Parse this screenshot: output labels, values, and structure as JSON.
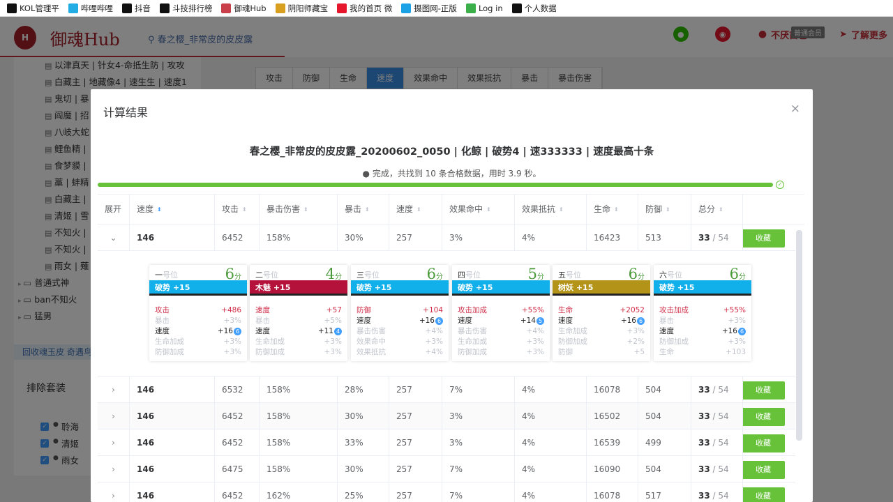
{
  "bookmarks": [
    {
      "label": "KOL管理平",
      "icon": "dawa-icon",
      "color": "#111111"
    },
    {
      "label": "哔哩哔哩",
      "icon": "bilibili-icon",
      "color": "#23ade5"
    },
    {
      "label": "抖音",
      "icon": "tiktok-icon",
      "color": "#111111"
    },
    {
      "label": "斗技排行榜",
      "icon": "dawa-icon",
      "color": "#111111"
    },
    {
      "label": "御魂Hub",
      "icon": "hub-icon",
      "color": "#c9404a"
    },
    {
      "label": "阴阳师藏宝",
      "icon": "cbg-icon",
      "color": "#d9a020"
    },
    {
      "label": "我的首页 微",
      "icon": "weibo-icon",
      "color": "#e6162d"
    },
    {
      "label": "摄图网-正版",
      "icon": "photo-icon",
      "color": "#1aa1e6"
    },
    {
      "label": "Log in",
      "icon": "px-icon",
      "color": "#3bb04a"
    },
    {
      "label": "个人数据",
      "icon": "dawa-icon",
      "color": "#111111"
    }
  ],
  "header": {
    "logo_text": "御魂Hub",
    "search_text": "春之樱_非常皮的皮皮露",
    "user_name": "不厌酋色",
    "member_badge": "普通会员",
    "more_link": "了解更多"
  },
  "sidebar": {
    "tree_items": [
      "以津真天 | 针女4-命抵生防 | 攻攻",
      "白藏主 | 地藏像4 | 速生生 | 速度1",
      "鬼切 | 暴",
      "阎魔 | 招",
      "八岐大蛇",
      "鲤鱼精 |",
      "食梦貘 |",
      "藁 | 蚌精",
      "白藏主 |",
      "清姬 | 雪",
      "不知火 |",
      "不知火 |",
      "雨女 | 薙"
    ],
    "folders": [
      "普通式神",
      "ban不知火",
      "猛男"
    ],
    "bar_text": "回收魂玉皮 奇遇鸟",
    "exclude_title": "排除套装",
    "checked_items": [
      "聆海",
      "清姬",
      "雨女"
    ]
  },
  "bg_tabs": [
    "攻击",
    "防御",
    "生命",
    "速度",
    "效果命中",
    "效果抵抗",
    "暴击",
    "暴击伤害"
  ],
  "bg_active_tab": "速度",
  "modal": {
    "title": "计算结果",
    "close_label": "×",
    "result_title": "春之樱_非常皮的皮皮露_20200602_0050 | 化鲸 | 破势4 | 速333333 | 速度最高十条",
    "done_text": "完成，共找到 10 条合格数据，用时 3.9 秒。",
    "progress_pct": 100,
    "columns": [
      "展开",
      "速度",
      "攻击",
      "暴击伤害",
      "暴击",
      "速度",
      "效果命中",
      "效果抵抗",
      "生命",
      "防御",
      "总分"
    ],
    "fav_label": "收藏",
    "rows": [
      {
        "speed": "146",
        "atk": "6452",
        "cdmg": "158%",
        "crit": "30%",
        "spd": "257",
        "hit": "3%",
        "res": "4%",
        "hp": "16423",
        "def": "513",
        "score": "33",
        "total": " / 54"
      },
      {
        "speed": "146",
        "atk": "6532",
        "cdmg": "158%",
        "crit": "28%",
        "spd": "257",
        "hit": "7%",
        "res": "4%",
        "hp": "16078",
        "def": "504",
        "score": "33",
        "total": " / 54"
      },
      {
        "speed": "146",
        "atk": "6452",
        "cdmg": "158%",
        "crit": "30%",
        "spd": "257",
        "hit": "3%",
        "res": "4%",
        "hp": "16502",
        "def": "504",
        "score": "33",
        "total": " / 54"
      },
      {
        "speed": "146",
        "atk": "6452",
        "cdmg": "158%",
        "crit": "33%",
        "spd": "257",
        "hit": "3%",
        "res": "4%",
        "hp": "16539",
        "def": "499",
        "score": "33",
        "total": " / 54"
      },
      {
        "speed": "146",
        "atk": "6475",
        "cdmg": "158%",
        "crit": "30%",
        "spd": "257",
        "hit": "7%",
        "res": "4%",
        "hp": "16090",
        "def": "504",
        "score": "33",
        "total": " / 54"
      },
      {
        "speed": "146",
        "atk": "6452",
        "cdmg": "162%",
        "crit": "25%",
        "spd": "257",
        "hit": "7%",
        "res": "4%",
        "hp": "16078",
        "def": "517",
        "score": "33",
        "total": " / 54"
      }
    ],
    "cards": [
      {
        "pos_num": "一",
        "pos_suffix": "号位",
        "score": "6",
        "score_unit": "分",
        "set": "破势 +15",
        "band_color": "#12b0ea",
        "stats": [
          {
            "name": "攻击",
            "val": "+486",
            "kind": "main"
          },
          {
            "name": "暴击",
            "val": "+3%",
            "kind": "sub"
          },
          {
            "name": "速度",
            "val": "+16",
            "roll": "6",
            "kind": "spd"
          },
          {
            "name": "生命加成",
            "val": "+3%",
            "kind": "sub"
          },
          {
            "name": "防御加成",
            "val": "+3%",
            "kind": "sub"
          }
        ]
      },
      {
        "pos_num": "二",
        "pos_suffix": "号位",
        "score": "4",
        "score_unit": "分",
        "set": "木魅 +15",
        "band_color": "#b5123b",
        "stats": [
          {
            "name": "速度",
            "val": "+57",
            "kind": "main"
          },
          {
            "name": "暴击",
            "val": "+5%",
            "kind": "sub"
          },
          {
            "name": "速度",
            "val": "+11",
            "roll": "4",
            "kind": "spd"
          },
          {
            "name": "生命加成",
            "val": "+3%",
            "kind": "sub"
          },
          {
            "name": "防御加成",
            "val": "+3%",
            "kind": "sub"
          }
        ]
      },
      {
        "pos_num": "三",
        "pos_suffix": "号位",
        "score": "6",
        "score_unit": "分",
        "set": "破势 +15",
        "band_color": "#12b0ea",
        "stats": [
          {
            "name": "防御",
            "val": "+104",
            "kind": "main"
          },
          {
            "name": "速度",
            "val": "+16",
            "roll": "6",
            "kind": "spd"
          },
          {
            "name": "暴击伤害",
            "val": "+4%",
            "kind": "sub"
          },
          {
            "name": "效果命中",
            "val": "+3%",
            "kind": "sub"
          },
          {
            "name": "效果抵抗",
            "val": "+4%",
            "kind": "sub"
          }
        ]
      },
      {
        "pos_num": "四",
        "pos_suffix": "号位",
        "score": "5",
        "score_unit": "分",
        "set": "破势 +15",
        "band_color": "#12b0ea",
        "stats": [
          {
            "name": "攻击加成",
            "val": "+55%",
            "kind": "main"
          },
          {
            "name": "速度",
            "val": "+14",
            "roll": "5",
            "kind": "spd"
          },
          {
            "name": "暴击伤害",
            "val": "+4%",
            "kind": "sub"
          },
          {
            "name": "生命加成",
            "val": "+3%",
            "kind": "sub"
          },
          {
            "name": "防御加成",
            "val": "+3%",
            "kind": "sub"
          }
        ]
      },
      {
        "pos_num": "五",
        "pos_suffix": "号位",
        "score": "6",
        "score_unit": "分",
        "set": "树妖 +15",
        "band_color": "#b39418",
        "stats": [
          {
            "name": "生命",
            "val": "+2052",
            "kind": "main"
          },
          {
            "name": "速度",
            "val": "+16",
            "roll": "6",
            "kind": "spd"
          },
          {
            "name": "生命加成",
            "val": "+3%",
            "kind": "sub"
          },
          {
            "name": "防御加成",
            "val": "+2%",
            "kind": "sub"
          },
          {
            "name": "防御",
            "val": "+5",
            "kind": "sub"
          }
        ]
      },
      {
        "pos_num": "六",
        "pos_suffix": "号位",
        "score": "6",
        "score_unit": "分",
        "set": "破势 +15",
        "band_color": "#12b0ea",
        "stats": [
          {
            "name": "攻击加成",
            "val": "+55%",
            "kind": "main"
          },
          {
            "name": "暴击",
            "val": "+3%",
            "kind": "sub"
          },
          {
            "name": "速度",
            "val": "+16",
            "roll": "6",
            "kind": "spd"
          },
          {
            "name": "防御加成",
            "val": "+3%",
            "kind": "sub"
          },
          {
            "name": "生命",
            "val": "+103",
            "kind": "sub"
          }
        ]
      }
    ]
  }
}
